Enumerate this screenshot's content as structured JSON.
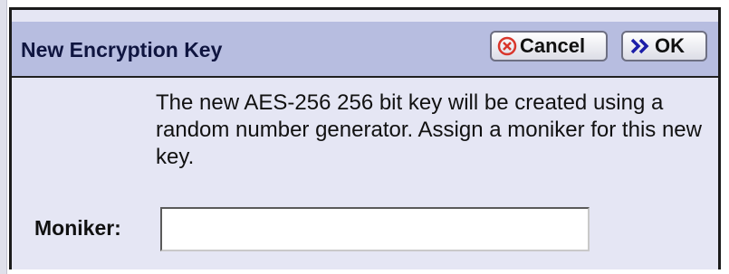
{
  "dialog": {
    "title": "New Encryption Key",
    "cancel_label": "Cancel",
    "ok_label": "OK",
    "cancel_icon": "cancel-circle-x-icon",
    "ok_icon": "double-chevron-right-icon",
    "description": "The new AES-256 256 bit key will be created using a random number generator. Assign a moniker for this new key.",
    "moniker_label": "Moniker:",
    "moniker_value": ""
  },
  "colors": {
    "title_bar": "#b7bde0",
    "dialog_background": "#e5e6f4",
    "cancel_icon_color": "#d9362b",
    "ok_icon_color": "#1c1ea8"
  }
}
